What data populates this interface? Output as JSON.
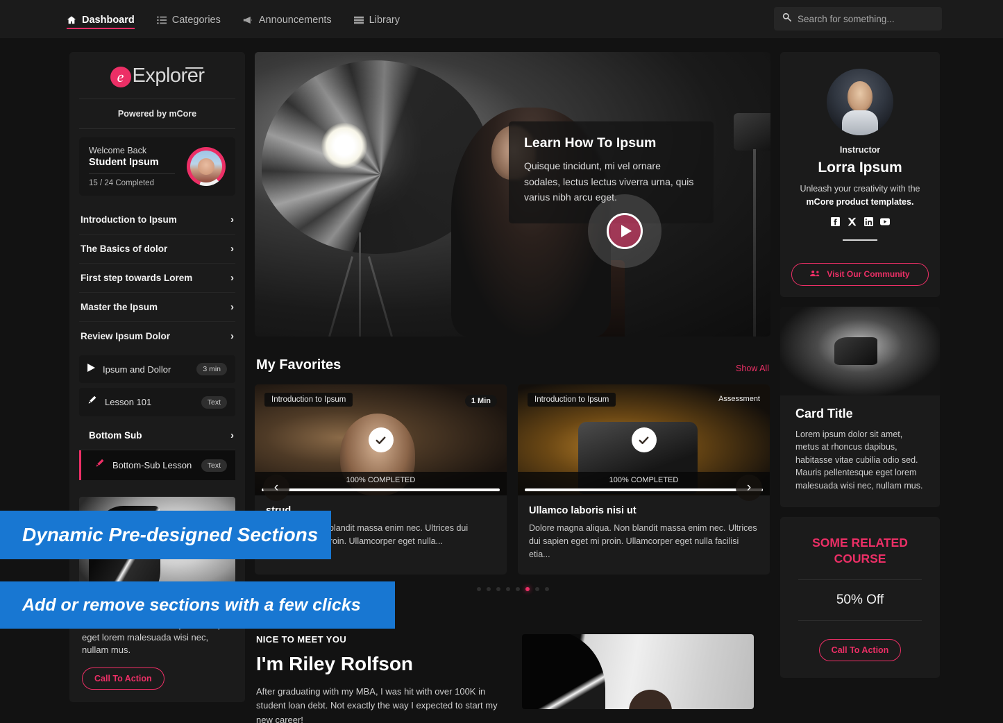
{
  "nav": {
    "items": [
      {
        "label": "Dashboard",
        "icon": "home-icon",
        "active": true
      },
      {
        "label": "Categories",
        "icon": "list-icon",
        "active": false
      },
      {
        "label": "Announcements",
        "icon": "megaphone-icon",
        "active": false
      },
      {
        "label": "Library",
        "icon": "grid-icon",
        "active": false
      }
    ],
    "search_placeholder": "Search for something..."
  },
  "sidebar": {
    "brand_mark": "e",
    "brand_name": "Explorer",
    "powered_by": "Powered by mCore",
    "welcome": {
      "greeting": "Welcome Back",
      "name": "Student Ipsum",
      "progress": "15 / 24 Completed"
    },
    "toc": [
      {
        "label": "Introduction to Ipsum"
      },
      {
        "label": "The Basics of dolor"
      },
      {
        "label": "First step towards Lorem"
      },
      {
        "label": "Master the Ipsum"
      },
      {
        "label": "Review Ipsum Dolor"
      }
    ],
    "lessons": [
      {
        "label": "Ipsum and Dollor",
        "badge": "3 min",
        "icon": "play-icon"
      },
      {
        "label": "Lesson 101",
        "badge": "Text",
        "icon": "pencil-icon"
      }
    ],
    "sub_heading": "Bottom Sub",
    "sub_lesson": {
      "label": "Bottom-Sub Lesson",
      "badge": "Text",
      "icon": "pencil-icon"
    },
    "bottom_card": {
      "text": "cubilia odio sed. Mauris pellentesque eget lorem malesuada wisi nec, nullam mus.",
      "cta": "Call To Action"
    }
  },
  "hero": {
    "title": "Learn How To Ipsum",
    "desc": "Quisque tincidunt, mi vel ornare sodales, lectus lectus viverra urna, quis varius nibh arcu eget.",
    "play_icon": "play-icon"
  },
  "favorites": {
    "title": "My Favorites",
    "show_all": "Show All",
    "cards": [
      {
        "tag": "Introduction to Ipsum",
        "meta": "1 Min",
        "progress_label": "100% COMPLETED",
        "progress_pct": 100,
        "title": "strud",
        "desc": "gna aliqua. Non blandit massa enim nec. Ultrices dui sapien eget mi proin. Ullamcorper eget nulla..."
      },
      {
        "tag": "Introduction to Ipsum",
        "meta": "Assessment",
        "progress_label": "100% COMPLETED",
        "progress_pct": 100,
        "title": "Ullamco laboris nisi ut",
        "desc": "Dolore magna aliqua. Non blandit massa enim nec. Ultrices dui sapien eget mi proin. Ullamcorper eget nulla facilisi etia..."
      }
    ],
    "dots_total": 8,
    "dots_active_index": 5,
    "prev_icon": "chevron-left-icon",
    "next_icon": "chevron-right-icon"
  },
  "meet": {
    "kicker": "NICE TO MEET YOU",
    "name": "I'm Riley Rolfson",
    "paragraph": "After graduating with my MBA, I was hit with over 100K in student loan debt. Not exactly the way I expected to start my new career!"
  },
  "right": {
    "instructor": {
      "role": "Instructor",
      "name": "Lorra Ipsum",
      "bio_part1": "Unleash your creativity with the ",
      "bio_part2": "mCore product templates.",
      "socials": [
        "facebook-icon",
        "x-icon",
        "linkedin-icon",
        "youtube-icon"
      ],
      "community_button": "Visit Our Community"
    },
    "card": {
      "title": "Card Title",
      "text": "Lorem ipsum dolor sit amet, metus at rhoncus dapibus, habitasse vitae cubilia odio sed. Mauris pellentesque eget lorem malesuada wisi nec, nullam mus."
    },
    "promo": {
      "title": "SOME RELATED COURSE",
      "discount": "50% Off",
      "cta": "Call To Action"
    }
  },
  "annotations": [
    {
      "text": "Dynamic Pre-designed Sections"
    },
    {
      "text": "Add or remove sections with a few clicks"
    }
  ],
  "colors": {
    "accent": "#ec2f66",
    "annotation": "#1877d2",
    "bg": "#121212",
    "panel": "#1b1b1b"
  }
}
